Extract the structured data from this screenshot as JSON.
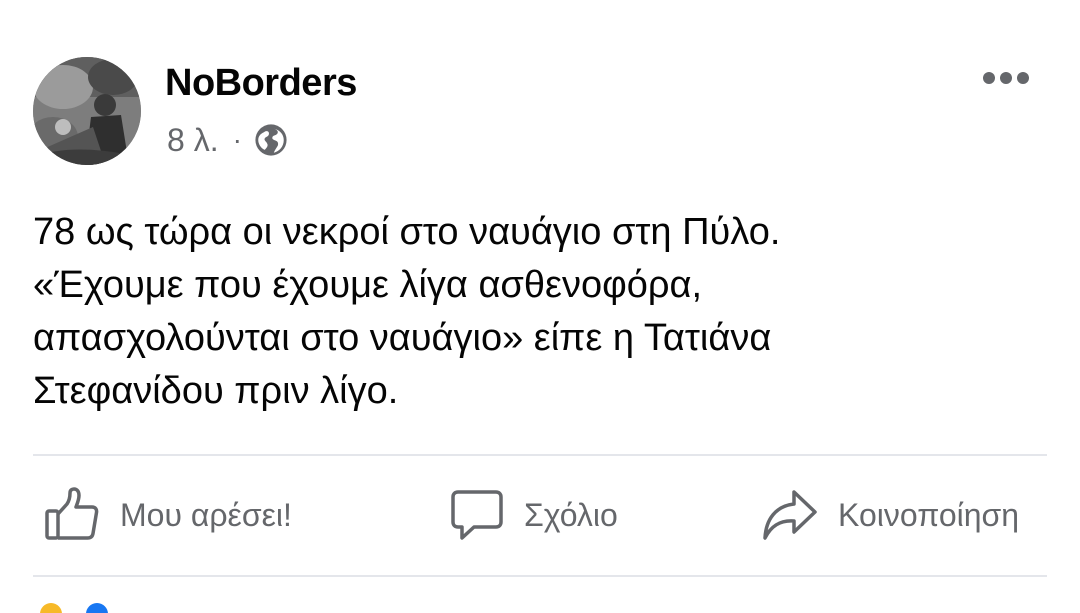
{
  "post": {
    "author": "NoBorders",
    "time": "8 λ.",
    "separator": "·",
    "privacy_icon": "globe-icon",
    "more_icon": "more-horizontal-icon",
    "text_lines": [
      "78 ως τώρα οι νεκροί στο ναυάγιο στη Πύλο.",
      "«Έχουμε που έχουμε λίγα ασθενοφόρα,",
      "απασχολούνται στο ναυάγιο» είπε η Τατιάνα",
      "Στεφανίδου πριν λίγο."
    ]
  },
  "actions": {
    "like_label": "Μου αρέσει!",
    "comment_label": "Σχόλιο",
    "share_label": "Κοινοποίηση"
  },
  "colors": {
    "text": "#050505",
    "secondary": "#65676b",
    "divider": "#e4e6eb"
  }
}
